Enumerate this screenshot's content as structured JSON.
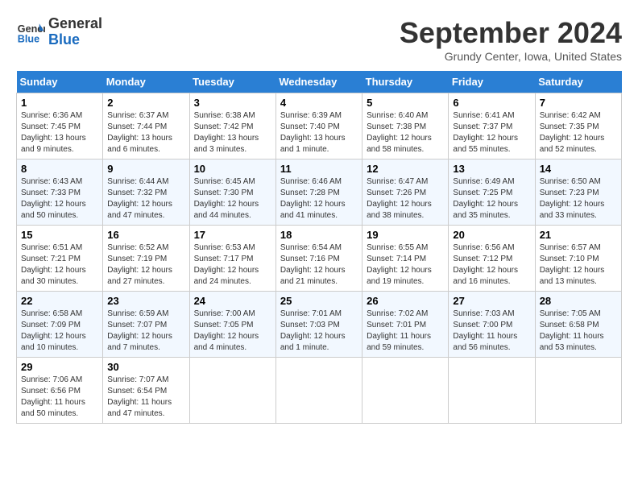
{
  "header": {
    "logo_line1": "General",
    "logo_line2": "Blue",
    "month": "September 2024",
    "location": "Grundy Center, Iowa, United States"
  },
  "weekdays": [
    "Sunday",
    "Monday",
    "Tuesday",
    "Wednesday",
    "Thursday",
    "Friday",
    "Saturday"
  ],
  "weeks": [
    [
      {
        "day": "1",
        "sunrise": "6:36 AM",
        "sunset": "7:45 PM",
        "daylight": "13 hours and 9 minutes."
      },
      {
        "day": "2",
        "sunrise": "6:37 AM",
        "sunset": "7:44 PM",
        "daylight": "13 hours and 6 minutes."
      },
      {
        "day": "3",
        "sunrise": "6:38 AM",
        "sunset": "7:42 PM",
        "daylight": "13 hours and 3 minutes."
      },
      {
        "day": "4",
        "sunrise": "6:39 AM",
        "sunset": "7:40 PM",
        "daylight": "13 hours and 1 minute."
      },
      {
        "day": "5",
        "sunrise": "6:40 AM",
        "sunset": "7:38 PM",
        "daylight": "12 hours and 58 minutes."
      },
      {
        "day": "6",
        "sunrise": "6:41 AM",
        "sunset": "7:37 PM",
        "daylight": "12 hours and 55 minutes."
      },
      {
        "day": "7",
        "sunrise": "6:42 AM",
        "sunset": "7:35 PM",
        "daylight": "12 hours and 52 minutes."
      }
    ],
    [
      {
        "day": "8",
        "sunrise": "6:43 AM",
        "sunset": "7:33 PM",
        "daylight": "12 hours and 50 minutes."
      },
      {
        "day": "9",
        "sunrise": "6:44 AM",
        "sunset": "7:32 PM",
        "daylight": "12 hours and 47 minutes."
      },
      {
        "day": "10",
        "sunrise": "6:45 AM",
        "sunset": "7:30 PM",
        "daylight": "12 hours and 44 minutes."
      },
      {
        "day": "11",
        "sunrise": "6:46 AM",
        "sunset": "7:28 PM",
        "daylight": "12 hours and 41 minutes."
      },
      {
        "day": "12",
        "sunrise": "6:47 AM",
        "sunset": "7:26 PM",
        "daylight": "12 hours and 38 minutes."
      },
      {
        "day": "13",
        "sunrise": "6:49 AM",
        "sunset": "7:25 PM",
        "daylight": "12 hours and 35 minutes."
      },
      {
        "day": "14",
        "sunrise": "6:50 AM",
        "sunset": "7:23 PM",
        "daylight": "12 hours and 33 minutes."
      }
    ],
    [
      {
        "day": "15",
        "sunrise": "6:51 AM",
        "sunset": "7:21 PM",
        "daylight": "12 hours and 30 minutes."
      },
      {
        "day": "16",
        "sunrise": "6:52 AM",
        "sunset": "7:19 PM",
        "daylight": "12 hours and 27 minutes."
      },
      {
        "day": "17",
        "sunrise": "6:53 AM",
        "sunset": "7:17 PM",
        "daylight": "12 hours and 24 minutes."
      },
      {
        "day": "18",
        "sunrise": "6:54 AM",
        "sunset": "7:16 PM",
        "daylight": "12 hours and 21 minutes."
      },
      {
        "day": "19",
        "sunrise": "6:55 AM",
        "sunset": "7:14 PM",
        "daylight": "12 hours and 19 minutes."
      },
      {
        "day": "20",
        "sunrise": "6:56 AM",
        "sunset": "7:12 PM",
        "daylight": "12 hours and 16 minutes."
      },
      {
        "day": "21",
        "sunrise": "6:57 AM",
        "sunset": "7:10 PM",
        "daylight": "12 hours and 13 minutes."
      }
    ],
    [
      {
        "day": "22",
        "sunrise": "6:58 AM",
        "sunset": "7:09 PM",
        "daylight": "12 hours and 10 minutes."
      },
      {
        "day": "23",
        "sunrise": "6:59 AM",
        "sunset": "7:07 PM",
        "daylight": "12 hours and 7 minutes."
      },
      {
        "day": "24",
        "sunrise": "7:00 AM",
        "sunset": "7:05 PM",
        "daylight": "12 hours and 4 minutes."
      },
      {
        "day": "25",
        "sunrise": "7:01 AM",
        "sunset": "7:03 PM",
        "daylight": "12 hours and 1 minute."
      },
      {
        "day": "26",
        "sunrise": "7:02 AM",
        "sunset": "7:01 PM",
        "daylight": "11 hours and 59 minutes."
      },
      {
        "day": "27",
        "sunrise": "7:03 AM",
        "sunset": "7:00 PM",
        "daylight": "11 hours and 56 minutes."
      },
      {
        "day": "28",
        "sunrise": "7:05 AM",
        "sunset": "6:58 PM",
        "daylight": "11 hours and 53 minutes."
      }
    ],
    [
      {
        "day": "29",
        "sunrise": "7:06 AM",
        "sunset": "6:56 PM",
        "daylight": "11 hours and 50 minutes."
      },
      {
        "day": "30",
        "sunrise": "7:07 AM",
        "sunset": "6:54 PM",
        "daylight": "11 hours and 47 minutes."
      },
      null,
      null,
      null,
      null,
      null
    ]
  ],
  "labels": {
    "sunrise": "Sunrise:",
    "sunset": "Sunset:",
    "daylight": "Daylight:"
  }
}
